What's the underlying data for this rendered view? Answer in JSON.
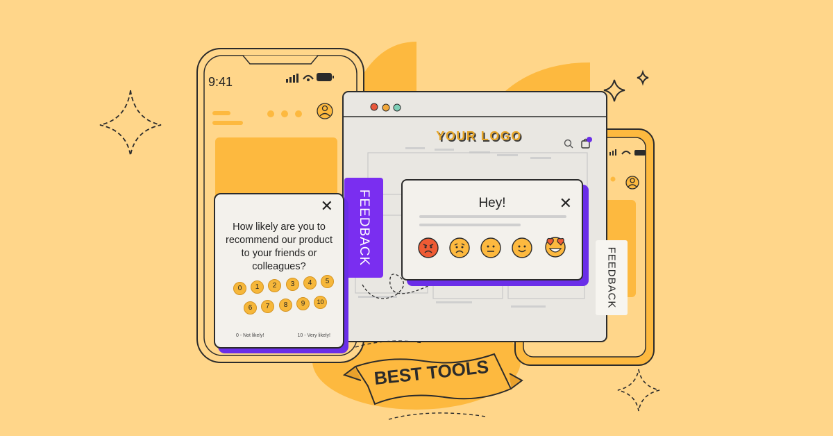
{
  "colors": {
    "background": "#FFD68A",
    "accent_yellow": "#FDB93F",
    "purple": "#7A2EF0",
    "card": "#F3F1EC",
    "outline": "#2B2B2B"
  },
  "phone_left": {
    "time": "9:41",
    "status_icons": [
      "signal-icon",
      "wifi-icon",
      "battery-icon"
    ],
    "profile_icon": "user-icon"
  },
  "survey": {
    "question": "How likely are you to recommend our product to your friends or colleagues?",
    "close_icon": "close-icon",
    "scale": [
      "0",
      "1",
      "2",
      "3",
      "4",
      "5",
      "6",
      "7",
      "8",
      "9",
      "10"
    ],
    "low_label": "0 - Not likely!",
    "high_label": "10 - Very likely!"
  },
  "browser": {
    "window_dots": [
      "#E8573A",
      "#F2A83B",
      "#7ECFB8"
    ],
    "logo": "YOUR LOGO",
    "icons": [
      "search-icon",
      "cart-icon"
    ]
  },
  "hey_popup": {
    "title": "Hey!",
    "close_icon": "close-icon",
    "emojis": [
      "angry-face-icon",
      "sad-face-icon",
      "neutral-face-icon",
      "smiling-face-icon",
      "heart-eyes-face-icon"
    ]
  },
  "feedback_tab_purple": {
    "label": "FEEDBACK"
  },
  "feedback_tab_white": {
    "label": "FEEDBACK"
  },
  "banner": {
    "text": "BEST TOOLS"
  }
}
